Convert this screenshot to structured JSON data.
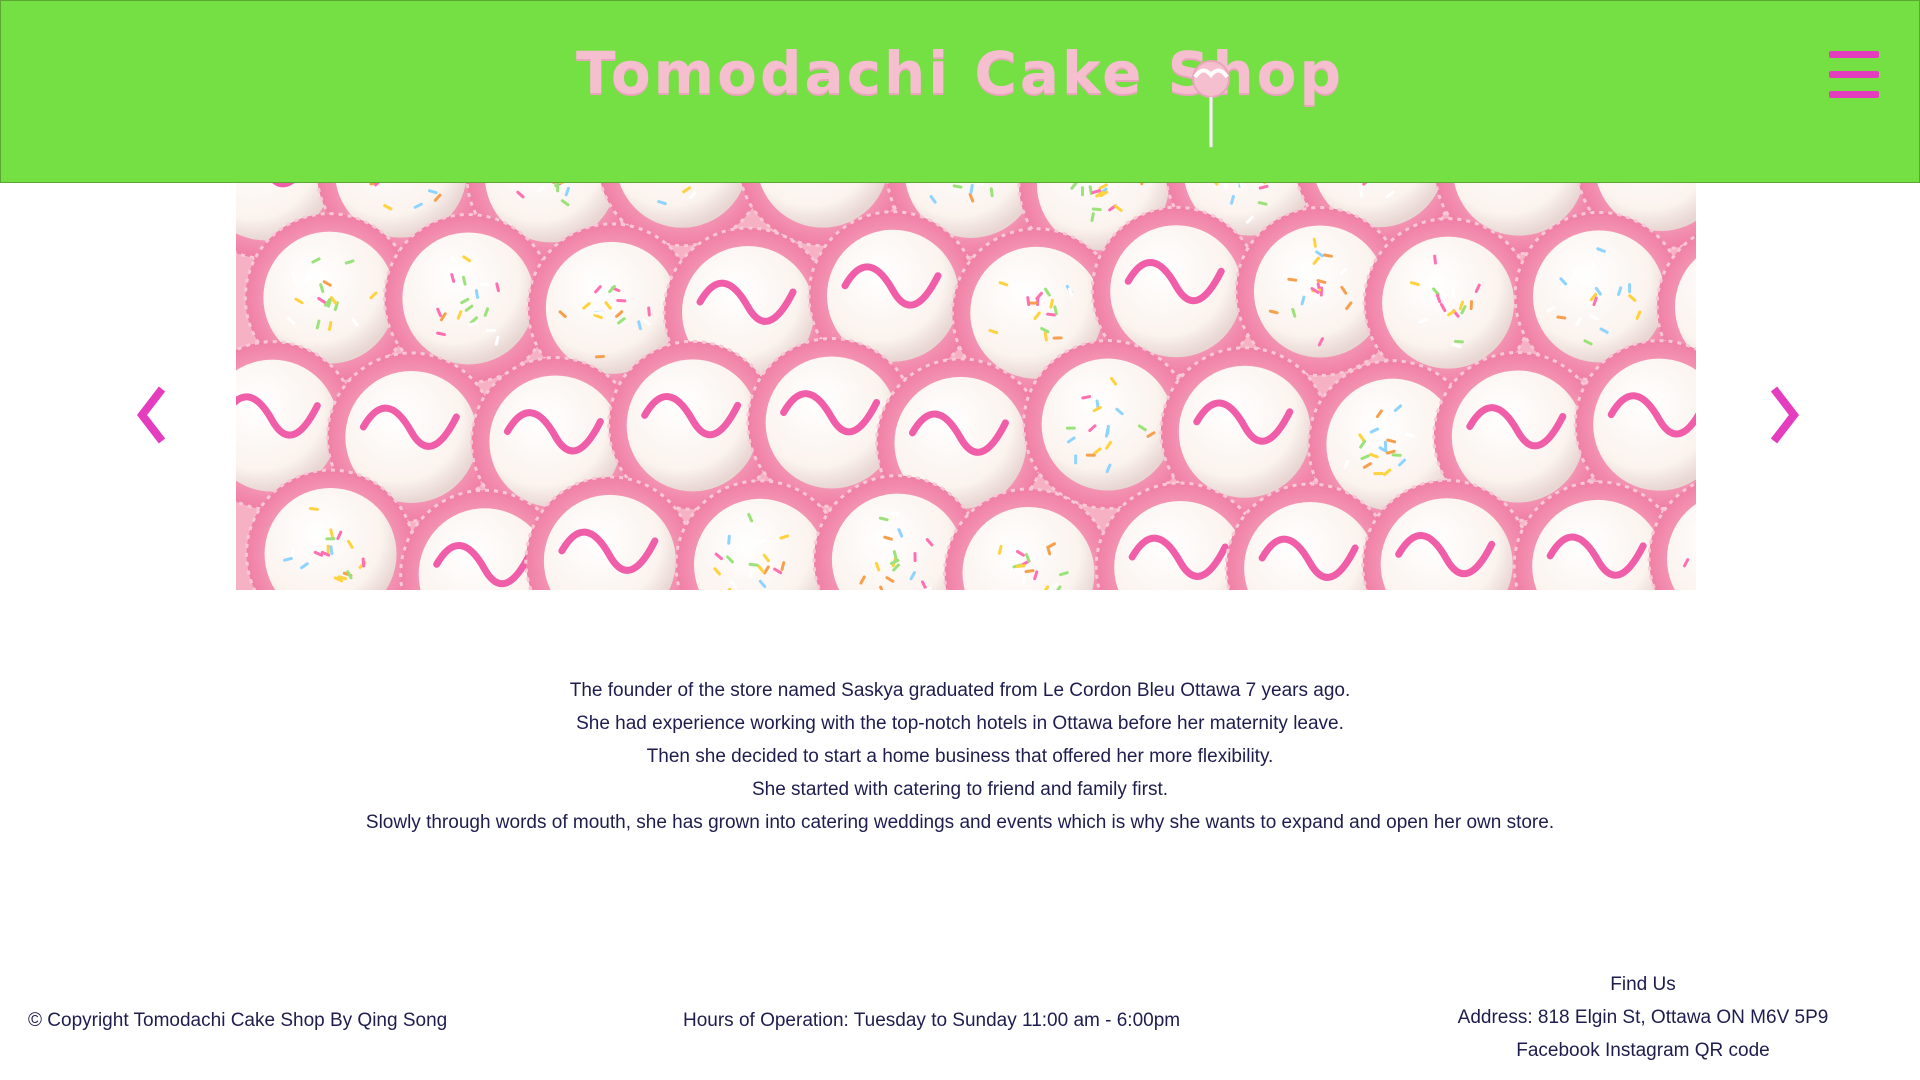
{
  "header": {
    "logo_text": "Tomodachi Cake Shop",
    "menu_icon": "hamburger-menu-icon",
    "background_color": "#75e043",
    "accent_color": "#e53dbf"
  },
  "carousel": {
    "image_description_icon": "cake-pops-photo",
    "prev_icon": "chevron-left-icon",
    "next_icon": "chevron-right-icon"
  },
  "about": {
    "lines": [
      "The founder of the store named Saskya graduated from Le Cordon Bleu Ottawa 7 years ago.",
      "She had experience working with the top-notch hotels in Ottawa before her maternity leave.",
      "Then she decided to start a home business that offered her more flexibility.",
      "She started with catering to friend and family first.",
      "Slowly through words of mouth, she has grown into catering weddings and events which is why she wants to expand and open her own store."
    ]
  },
  "footer": {
    "copyright": "© Copyright Tomodachi Cake Shop By Qing Song",
    "hours": "Hours of Operation: Tuesday to Sunday 11:00 am - 6:00pm",
    "find_us_title": "Find Us",
    "address": "Address: 818 Elgin St, Ottawa ON M6V 5P9",
    "social": {
      "facebook": "Facebook",
      "instagram": "Instagram",
      "qr_code": "QR code"
    }
  }
}
